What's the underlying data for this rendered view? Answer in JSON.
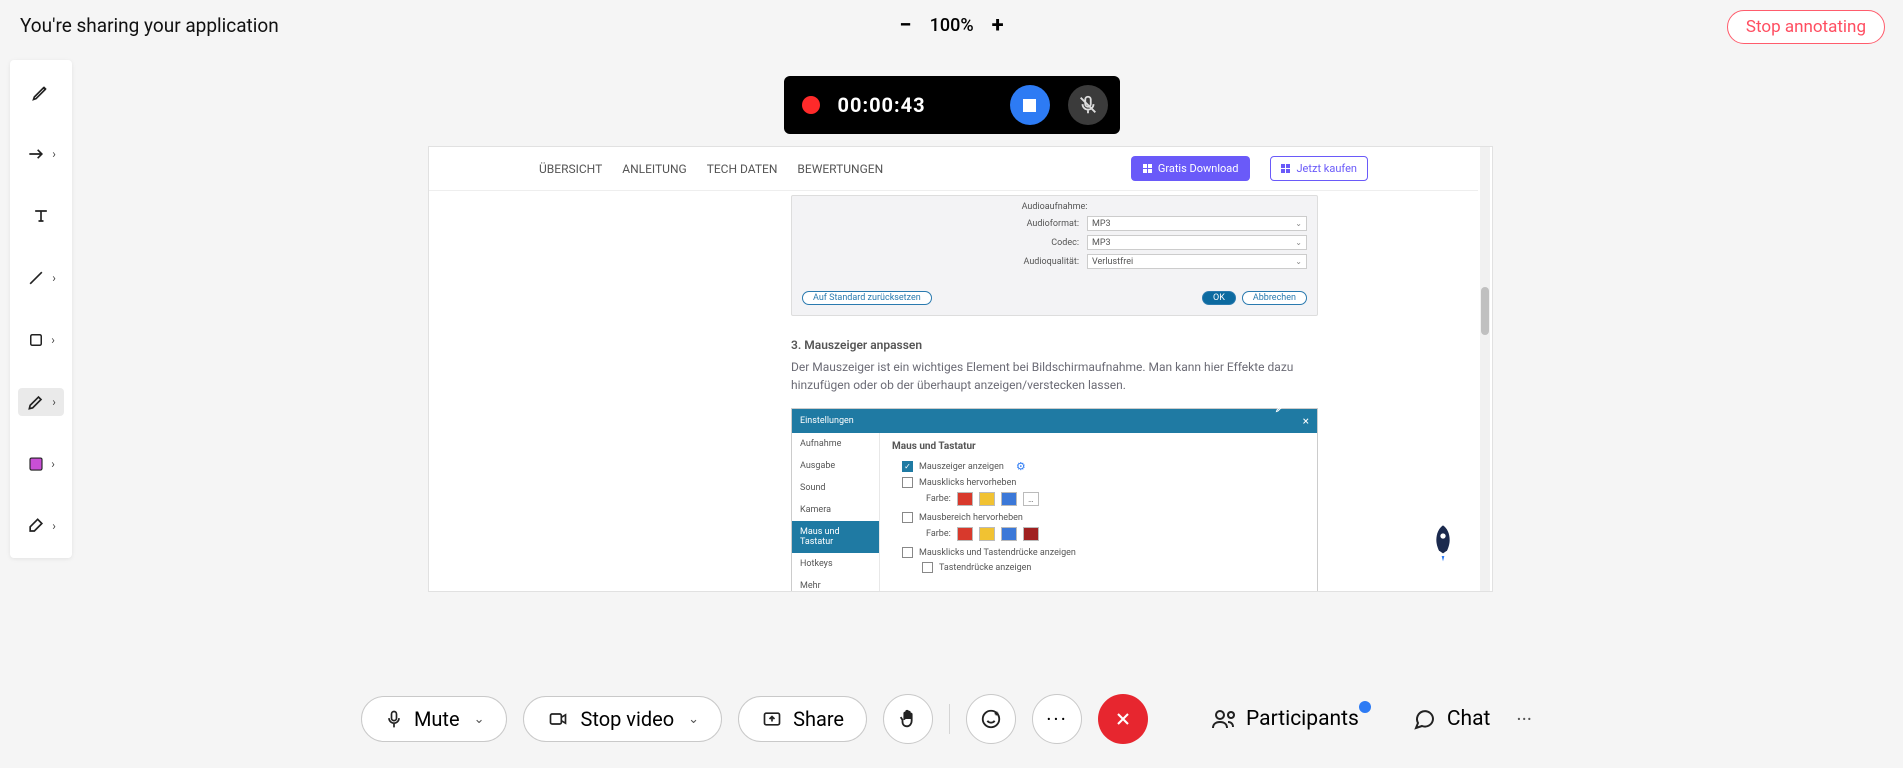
{
  "topbar": {
    "sharing_msg": "You're sharing your application",
    "zoom": {
      "minus": "−",
      "value": "100%",
      "plus": "+"
    },
    "stop_annot": "Stop annotating"
  },
  "recording": {
    "time": "00:00:43"
  },
  "shared_page": {
    "tabs": [
      "ÜBERSICHT",
      "ANLEITUNG",
      "TECH DATEN",
      "BEWERTUNGEN"
    ],
    "download_btn": "Gratis Download",
    "buy_btn": "Jetzt kaufen",
    "audio_section": {
      "heading": "Audioaufnahme:",
      "rows": [
        {
          "label": "Audioformat:",
          "value": "MP3"
        },
        {
          "label": "Codec:",
          "value": "MP3"
        },
        {
          "label": "Audioqualität:",
          "value": "Verlustfrei"
        }
      ],
      "reset_btn": "Auf Standard zurücksetzen",
      "ok_btn": "OK",
      "cancel_btn": "Abbrechen"
    },
    "para_heading": "3. Mauszeiger anpassen",
    "para_body": "Der Mauszeiger ist ein wichtiges Element bei Bildschirmaufnahme. Man kann hier Effekte dazu hinzufügen oder ob der überhaupt anzeigen/verstecken lassen.",
    "mouse_dialog": {
      "title": "Einstellungen",
      "side": [
        "Aufnahme",
        "Ausgabe",
        "Sound",
        "Kamera",
        "Maus und Tastatur",
        "Hotkeys",
        "Mehr"
      ],
      "side_selected": 4,
      "main_heading": "Maus und Tastatur",
      "row1": "Mauszeiger anzeigen",
      "row2": "Mausklicks hervorheben",
      "farbe": "Farbe:",
      "colors1": [
        "#d8392c",
        "#f1c232",
        "#3b78d8"
      ],
      "row3": "Mausbereich hervorheben",
      "colors2": [
        "#d8392c",
        "#f1c232",
        "#3b78d8",
        "#a02020"
      ],
      "row4": "Mausklicks und Tastendrücke anzeigen",
      "row5": "Tastendrücke anzeigen"
    }
  },
  "bottombar": {
    "mute": "Mute",
    "stop_video": "Stop video",
    "share": "Share",
    "participants": "Participants",
    "chat": "Chat"
  }
}
